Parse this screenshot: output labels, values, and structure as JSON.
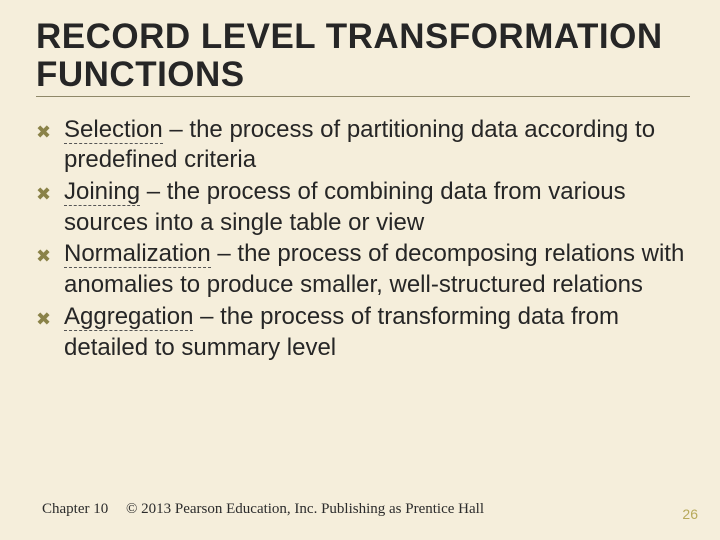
{
  "title": "RECORD LEVEL TRANSFORMATION FUNCTIONS",
  "items": [
    {
      "term": "Selection",
      "desc": " – the process of partitioning data according to predefined criteria"
    },
    {
      "term": "Joining",
      "desc": " – the process of combining data from various sources into a single table or view"
    },
    {
      "term": "Normalization",
      "desc": " – the process of decomposing relations with anomalies to produce smaller, well-structured relations"
    },
    {
      "term": "Aggregation",
      "desc": " – the process of transforming data from detailed to summary level"
    }
  ],
  "footer": {
    "chapter": "Chapter 10",
    "copyright": "© 2013 Pearson Education, Inc.  Publishing as Prentice Hall"
  },
  "page_number": "26",
  "bullet_glyph": "✖"
}
